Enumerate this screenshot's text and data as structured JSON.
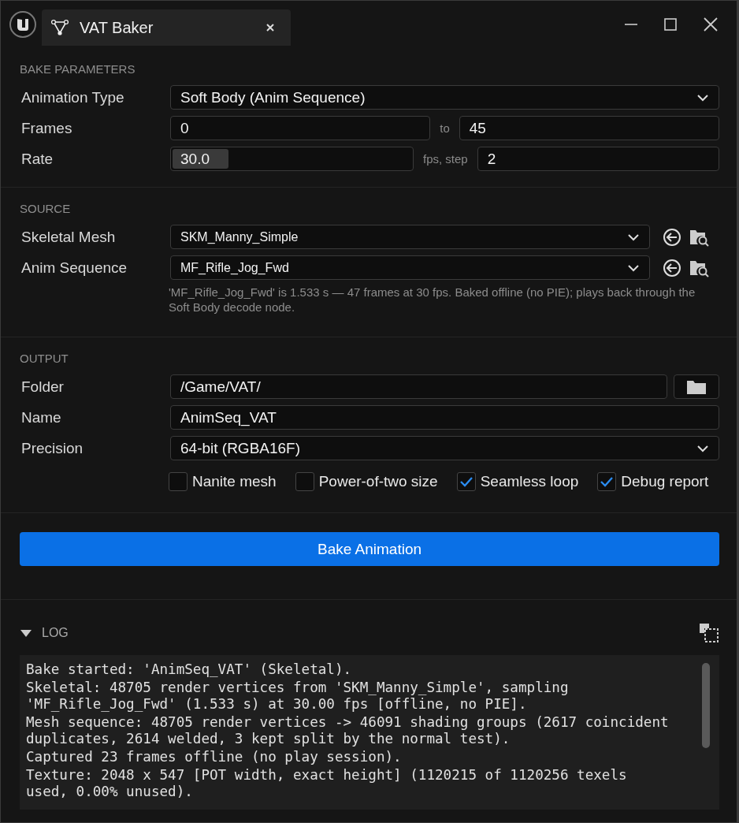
{
  "window": {
    "title": "VAT Baker"
  },
  "sections": [
    {
      "heading": "BAKE PARAMETERS",
      "rows": [
        {
          "kind": "dropdown",
          "label": "Animation Type",
          "value": "Soft Body (Anim Sequence)"
        },
        {
          "kind": "range",
          "label": "Frames",
          "from": "0",
          "separator": "to",
          "to": "45"
        },
        {
          "kind": "spin",
          "label": "Rate",
          "value": "30.0",
          "level": 0.23,
          "unit": "fps, step",
          "step": "2"
        }
      ]
    },
    {
      "heading": "SOURCE",
      "rows": [
        {
          "kind": "asset",
          "label": "Skeletal Mesh",
          "value": "SKM_Manny_Simple"
        },
        {
          "kind": "asset",
          "label": "Anim Sequence",
          "value": "MF_Rifle_Jog_Fwd"
        },
        {
          "kind": "note",
          "text": "'MF_Rifle_Jog_Fwd' is 1.533 s — 47 frames at 30 fps. Baked offline (no PIE); plays back through the Soft Body decode node."
        }
      ]
    },
    {
      "heading": "OUTPUT",
      "rows": [
        {
          "kind": "path",
          "label": "Folder",
          "value": "/Game/VAT/"
        },
        {
          "kind": "text",
          "label": "Name",
          "value": "AnimSeq_VAT"
        },
        {
          "kind": "dropdown",
          "label": "Precision",
          "value": "64-bit (RGBA16F)"
        },
        {
          "kind": "options",
          "options": [
            {
              "label": "Nanite mesh",
              "checked": false
            },
            {
              "label": "Power-of-two size",
              "checked": false
            },
            {
              "label": "Seamless loop",
              "checked": true
            },
            {
              "label": "Debug report",
              "checked": true
            }
          ]
        }
      ]
    }
  ],
  "bake_button": "Bake Animation",
  "log": {
    "title": "LOG",
    "expanded": true,
    "lines": [
      "Bake started: 'AnimSeq_VAT' (Skeletal).",
      "Skeletal: 48705 render vertices from 'SKM_Manny_Simple', sampling 'MF_Rifle_Jog_Fwd' (1.533 s) at 30.00 fps [offline, no PIE].",
      "Mesh sequence: 48705 render vertices -> 46091 shading groups (2617 coincident duplicates, 2614 welded, 3 kept split by the normal test).",
      "Captured 23 frames offline (no play session).",
      "Texture: 2048 x 547 [POT width, exact height] (1120215 of 1120256 texels used, 0.00% unused)."
    ]
  }
}
